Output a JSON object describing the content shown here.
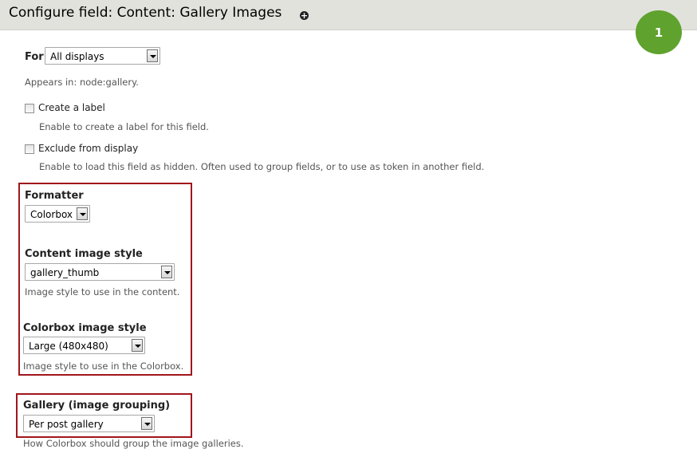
{
  "header": {
    "title": "Configure field: Content: Gallery Images",
    "add_icon": "plus-circle-icon"
  },
  "badge": {
    "number": "1",
    "color": "#5fa22e"
  },
  "for_field": {
    "label": "For",
    "selected": "All displays",
    "appears_in": "Appears in: node:gallery."
  },
  "create_label": {
    "label": "Create a label",
    "checked": false,
    "description": "Enable to create a label for this field."
  },
  "exclude_display": {
    "label": "Exclude from display",
    "checked": false,
    "description": "Enable to load this field as hidden. Often used to group fields, or to use as token in another field."
  },
  "formatter": {
    "label": "Formatter",
    "selected": "Colorbox"
  },
  "content_image_style": {
    "label": "Content image style",
    "selected": "gallery_thumb",
    "description": "Image style to use in the content."
  },
  "colorbox_image_style": {
    "label": "Colorbox image style",
    "selected": "Large (480x480)",
    "description": "Image style to use in the Colorbox."
  },
  "gallery_grouping": {
    "label": "Gallery (image grouping)",
    "selected": "Per post gallery",
    "description": "How Colorbox should group the image galleries."
  },
  "highlight_color": "#a0161c"
}
